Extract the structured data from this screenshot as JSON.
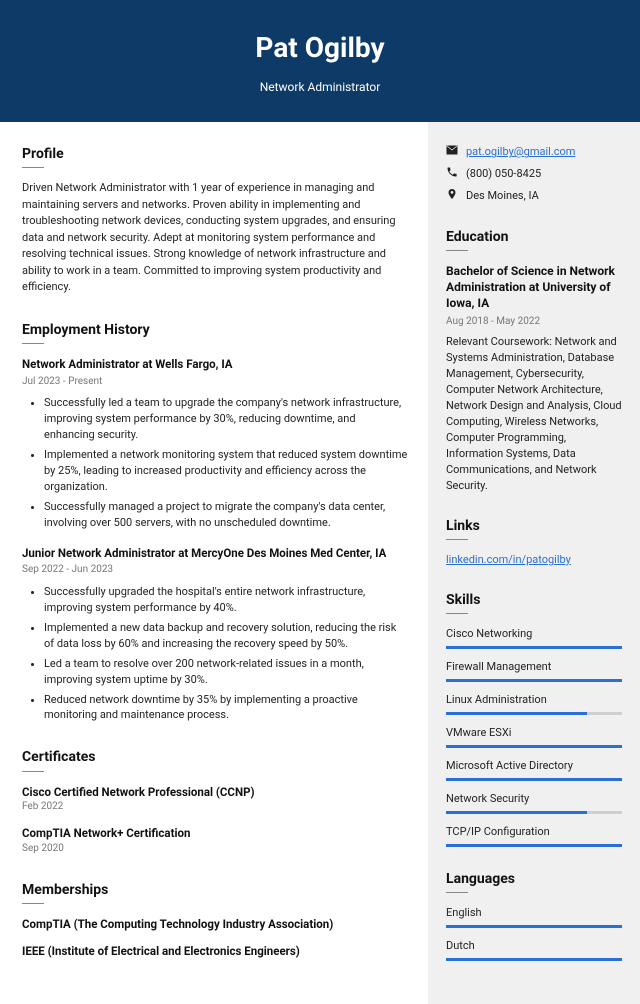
{
  "header": {
    "name": "Pat Ogilby",
    "title": "Network Administrator"
  },
  "contact": {
    "email": "pat.ogilby@gmail.com",
    "phone": "(800) 050-8425",
    "location": "Des Moines, IA"
  },
  "sections": {
    "profile": "Profile",
    "employment": "Employment History",
    "certificates": "Certificates",
    "memberships": "Memberships",
    "education": "Education",
    "links": "Links",
    "skills": "Skills",
    "languages": "Languages"
  },
  "profile_text": "Driven Network Administrator with 1 year of experience in managing and maintaining servers and networks. Proven ability in implementing and troubleshooting network devices, conducting system upgrades, and ensuring data and network security. Adept at monitoring system performance and resolving technical issues. Strong knowledge of network infrastructure and ability to work in a team. Committed to improving system productivity and efficiency.",
  "jobs": [
    {
      "title": "Network Administrator at Wells Fargo, IA",
      "dates": "Jul 2023 - Present",
      "bullets": [
        "Successfully led a team to upgrade the company's network infrastructure, improving system performance by 30%, reducing downtime, and enhancing security.",
        "Implemented a network monitoring system that reduced system downtime by 25%, leading to increased productivity and efficiency across the organization.",
        "Successfully managed a project to migrate the company's data center, involving over 500 servers, with no unscheduled downtime."
      ]
    },
    {
      "title": "Junior Network Administrator at MercyOne Des Moines Med Center, IA",
      "dates": "Sep 2022 - Jun 2023",
      "bullets": [
        "Successfully upgraded the hospital's entire network infrastructure, improving system performance by 40%.",
        "Implemented a new data backup and recovery solution, reducing the risk of data loss by 60% and increasing the recovery speed by 50%.",
        "Led a team to resolve over 200 network-related issues in a month, improving system uptime by 30%.",
        "Reduced network downtime by 35% by implementing a proactive monitoring and maintenance process."
      ]
    }
  ],
  "certificates": [
    {
      "title": "Cisco Certified Network Professional (CCNP)",
      "date": "Feb 2022"
    },
    {
      "title": "CompTIA Network+ Certification",
      "date": "Sep 2020"
    }
  ],
  "memberships": [
    {
      "title": "CompTIA (The Computing Technology Industry Association)"
    },
    {
      "title": "IEEE (Institute of Electrical and Electronics Engineers)"
    }
  ],
  "education": {
    "degree": "Bachelor of Science in Network Administration at University of Iowa, IA",
    "dates": "Aug 2018 - May 2022",
    "text": "Relevant Coursework: Network and Systems Administration, Database Management, Cybersecurity, Computer Network Architecture, Network Design and Analysis, Cloud Computing, Wireless Networks, Computer Programming, Information Systems, Data Communications, and Network Security."
  },
  "links": {
    "linkedin": "linkedin.com/in/patogilby"
  },
  "skills": [
    {
      "name": "Cisco Networking",
      "level": 100
    },
    {
      "name": "Firewall Management",
      "level": 100
    },
    {
      "name": "Linux Administration",
      "level": 80
    },
    {
      "name": "VMware ESXi",
      "level": 100
    },
    {
      "name": "Microsoft Active Directory",
      "level": 100
    },
    {
      "name": "Network Security",
      "level": 80
    },
    {
      "name": "TCP/IP Configuration",
      "level": 100
    }
  ],
  "languages": [
    {
      "name": "English",
      "level": 100
    },
    {
      "name": "Dutch",
      "level": 100
    }
  ]
}
